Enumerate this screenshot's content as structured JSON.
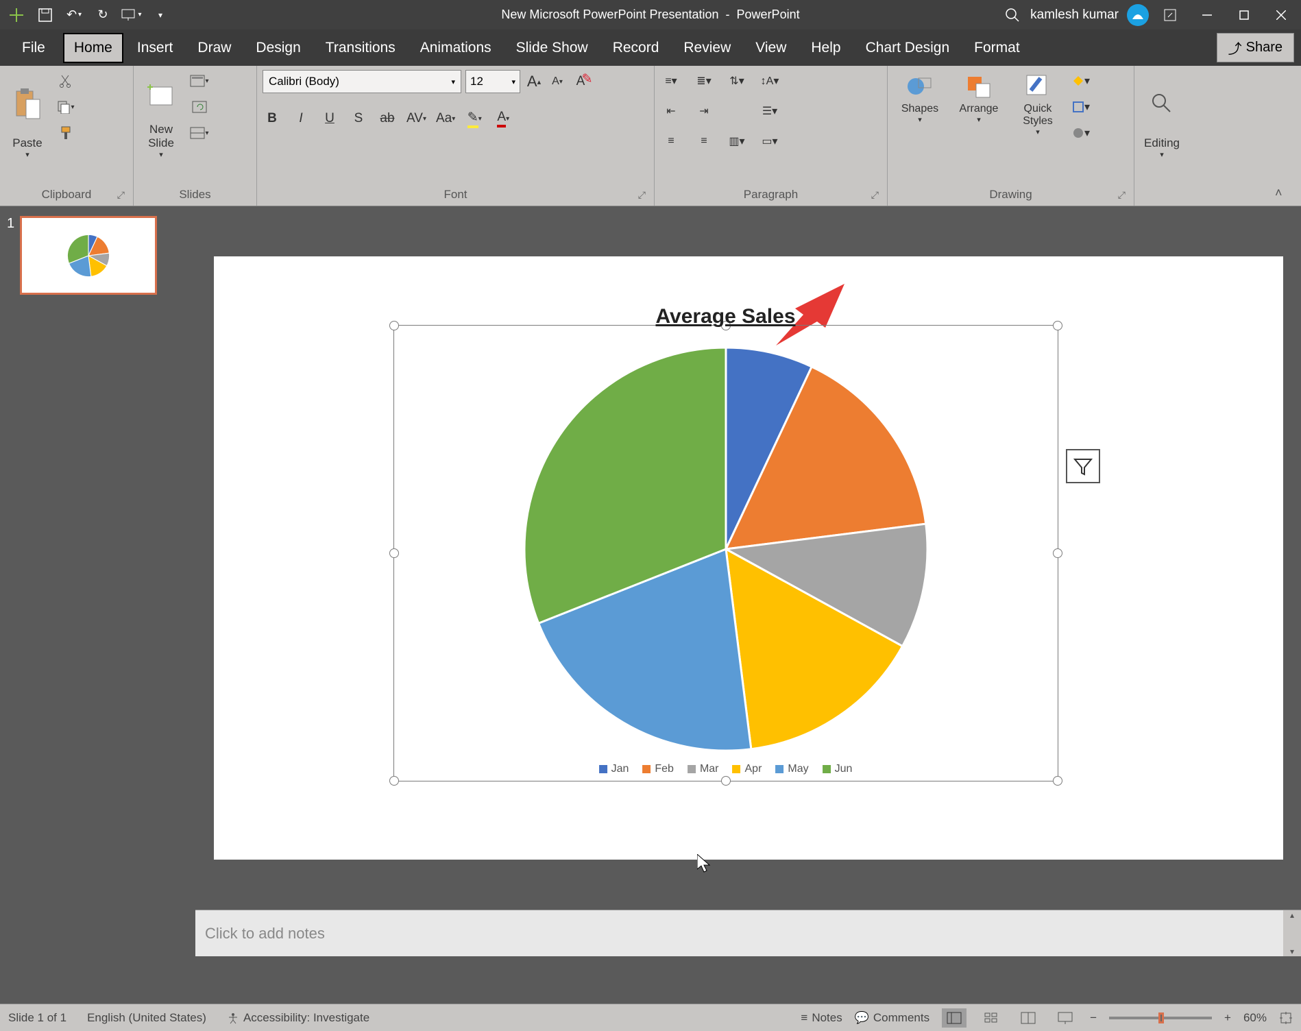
{
  "app": {
    "doc_title": "New Microsoft PowerPoint Presentation",
    "app_name": "PowerPoint",
    "user": "kamlesh kumar"
  },
  "qat": {
    "autosave": "Off"
  },
  "tabs": {
    "file": "File",
    "home": "Home",
    "insert": "Insert",
    "draw": "Draw",
    "design": "Design",
    "transitions": "Transitions",
    "animations": "Animations",
    "slideshow": "Slide Show",
    "record": "Record",
    "review": "Review",
    "view": "View",
    "help": "Help",
    "chartdesign": "Chart Design",
    "format": "Format",
    "share": "Share"
  },
  "ribbon": {
    "clipboard": {
      "label": "Clipboard",
      "paste": "Paste"
    },
    "slides": {
      "label": "Slides",
      "newslide": "New\nSlide"
    },
    "font": {
      "label": "Font",
      "name": "Calibri (Body)",
      "size": "12"
    },
    "paragraph": {
      "label": "Paragraph"
    },
    "drawing": {
      "label": "Drawing",
      "shapes": "Shapes",
      "arrange": "Arrange",
      "quickstyles": "Quick\nStyles"
    },
    "editing": {
      "label": "Editing",
      "button": "Editing"
    }
  },
  "thumb": {
    "num": "1"
  },
  "chart_data": {
    "type": "pie",
    "title": "Average Sales",
    "categories": [
      "Jan",
      "Feb",
      "Mar",
      "Apr",
      "May",
      "Jun"
    ],
    "values": [
      7,
      16,
      10,
      15,
      21,
      31
    ],
    "colors": [
      "#4472c4",
      "#ed7d31",
      "#a5a5a5",
      "#ffc000",
      "#5b9bd5",
      "#70ad47"
    ],
    "series": [
      {
        "name": "Average Sales",
        "values": [
          7,
          16,
          10,
          15,
          21,
          31
        ]
      }
    ]
  },
  "notes": {
    "placeholder": "Click to add notes"
  },
  "status": {
    "slide": "Slide 1 of 1",
    "lang": "English (United States)",
    "access": "Accessibility: Investigate",
    "notes": "Notes",
    "comments": "Comments",
    "zoom": "60%"
  }
}
